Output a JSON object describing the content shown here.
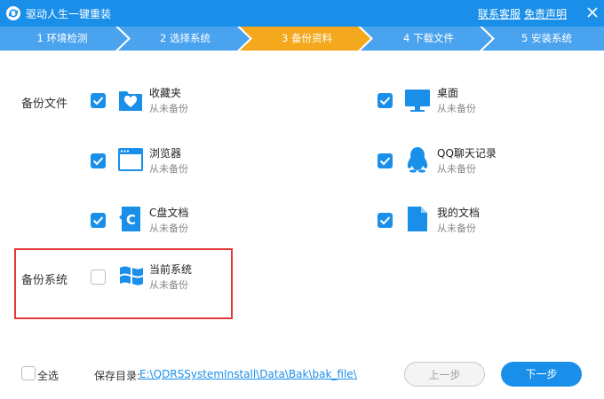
{
  "window": {
    "title": "驱动人生一键重装",
    "logo_icon": "refresh-logo-icon",
    "links": {
      "contact": "联系客服",
      "disclaimer": "免责声明"
    },
    "close_icon": "close-icon"
  },
  "steps": {
    "active_color": "#f4a81d",
    "inactive_color": "#4aa3ee",
    "items": [
      {
        "label": "1 环境检测",
        "active": false
      },
      {
        "label": "2 选择系统",
        "active": false
      },
      {
        "label": "3 备份资料",
        "active": true
      },
      {
        "label": "4 下载文件",
        "active": false
      },
      {
        "label": "5 安装系统",
        "active": false
      }
    ]
  },
  "backup_files": {
    "section_label": "备份文件",
    "items": [
      {
        "name": "收藏夹",
        "status": "从未备份",
        "checked": true,
        "icon": "favorites-folder-icon"
      },
      {
        "name": "桌面",
        "status": "从未备份",
        "checked": true,
        "icon": "desktop-monitor-icon"
      },
      {
        "name": "浏览器",
        "status": "从未备份",
        "checked": true,
        "icon": "browser-window-icon"
      },
      {
        "name": "QQ聊天记录",
        "status": "从未备份",
        "checked": true,
        "icon": "qq-penguin-icon"
      },
      {
        "name": "C盘文档",
        "status": "从未备份",
        "checked": true,
        "icon": "c-drive-document-icon"
      },
      {
        "name": "我的文档",
        "status": "从未备份",
        "checked": true,
        "icon": "my-documents-icon"
      }
    ]
  },
  "backup_system": {
    "section_label": "备份系统",
    "item": {
      "name": "当前系统",
      "status": "从未备份",
      "checked": false,
      "icon": "windows-logo-icon"
    }
  },
  "footer": {
    "select_all_label": "全选",
    "select_all_checked": false,
    "save_dir_label": "保存目录:",
    "save_dir_path": "E:\\QDRSSystemInstall\\Data\\Bak\\bak_file\\",
    "prev_button": "上一步",
    "next_button": "下一步"
  },
  "colors": {
    "brand_blue": "#1a8fe9",
    "highlight_red": "#e53935"
  }
}
